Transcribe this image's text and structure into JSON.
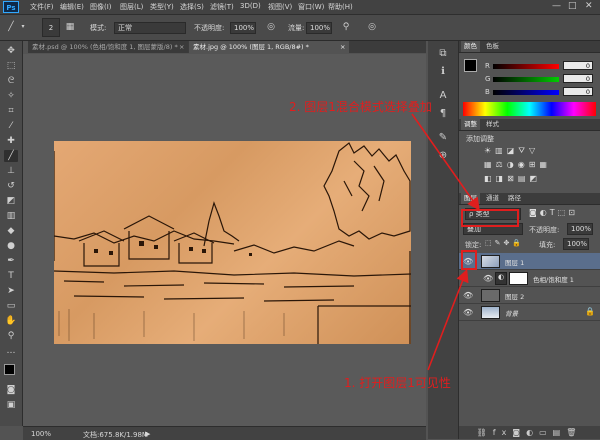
{
  "menubar": {
    "app": "Ps",
    "items": [
      "文件(F)",
      "编辑(E)",
      "图像(I)",
      "图层(L)",
      "类型(Y)",
      "选择(S)",
      "滤镜(T)",
      "3D(D)",
      "视图(V)",
      "窗口(W)",
      "帮助(H)"
    ],
    "min": "—",
    "max": "□",
    "close": "✕"
  },
  "options": {
    "brush_size": "2",
    "mode_label": "模式:",
    "mode_value": "正常",
    "opacity_label": "不透明度:",
    "opacity_value": "100%",
    "flow_label": "流量:",
    "flow_value": "100%"
  },
  "tabs": [
    {
      "label": "素材.psd @ 100% (色相/饱和度 1, 图层蒙版/8) *",
      "close": "×"
    },
    {
      "label": "素材.jpg @ 100% (图层 1, RGB/8#) *",
      "close": "×"
    }
  ],
  "status": {
    "zoom": "100%",
    "doc": "文档:675.8K/1.98M",
    "arrow": "▶"
  },
  "color_panel": {
    "tabs": [
      "颜色",
      "色板"
    ],
    "r_label": "R",
    "g_label": "G",
    "b_label": "B",
    "r": "0",
    "g": "0",
    "b": "0",
    "r_color": "#e02020",
    "g_color": "#20b020",
    "b_color": "#2040e0"
  },
  "adjust_panel": {
    "tabs": [
      "调整",
      "样式"
    ],
    "title": "添加调整"
  },
  "layers_panel": {
    "tabs": [
      "图层",
      "通道",
      "路径"
    ],
    "kind": "ρ 类型",
    "blend_mode": "叠加",
    "opacity_label": "不透明度:",
    "opacity_value": "100%",
    "lock_label": "锁定:",
    "fill_label": "填充:",
    "fill_value": "100%",
    "layers": [
      {
        "name": "图层 1",
        "selected": true
      },
      {
        "name": "色相/饱和度 1",
        "selected": false
      },
      {
        "name": "图层 2",
        "selected": false
      },
      {
        "name": "背景",
        "selected": false,
        "locked": true
      }
    ]
  },
  "annotations": {
    "top": "2. 图层1混合模式选择叠加",
    "bottom": "1. 打开图层1可见性",
    "color": "#e01e1e"
  }
}
